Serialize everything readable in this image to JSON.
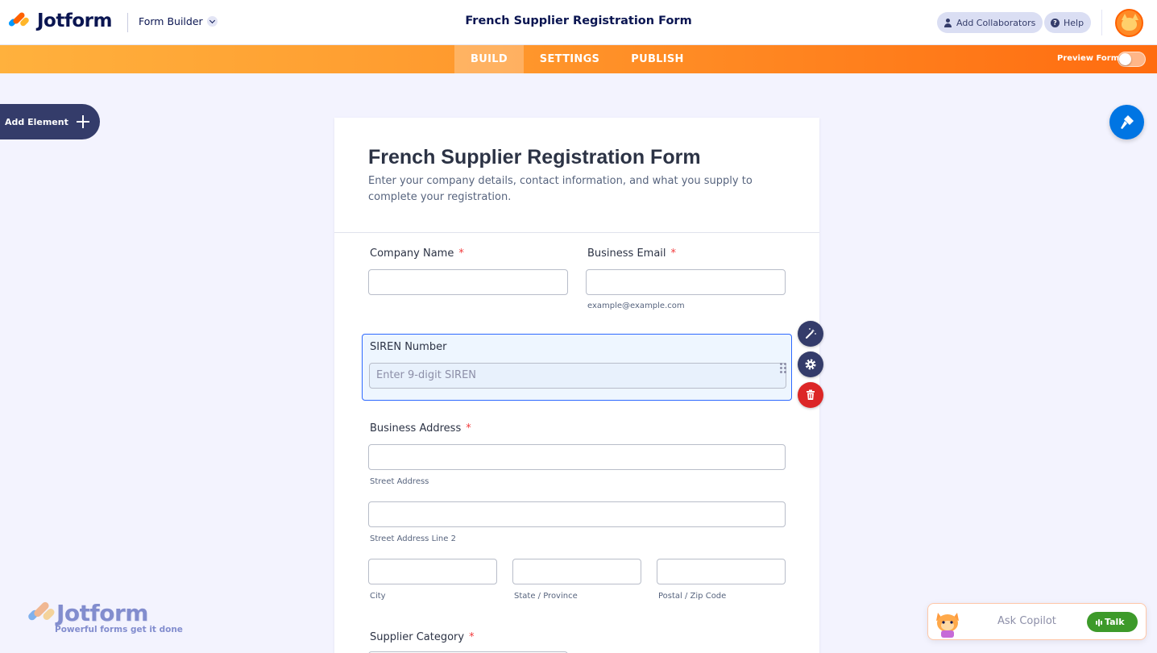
{
  "app": {
    "logo_text": "Jotform",
    "builder_label": "Form Builder",
    "form_title": "French Supplier Registration Form",
    "add_collaborators": "Add Collaborators",
    "help": "Help"
  },
  "nav": {
    "tabs": [
      "BUILD",
      "SETTINGS",
      "PUBLISH"
    ],
    "active_tab": "BUILD",
    "preview_label": "Preview Form",
    "preview_on": false
  },
  "sidebar": {
    "add_element": "Add Element"
  },
  "form": {
    "title": "French Supplier Registration Form",
    "subtitle": "Enter your company details, contact information, and what you supply to complete your registration.",
    "required_mark": "*",
    "company_name_label": "Company Name",
    "business_email_label": "Business Email",
    "email_sublabel": "example@example.com",
    "siren_label": "SIREN Number",
    "siren_placeholder": "Enter 9-digit SIREN",
    "address_label": "Business Address",
    "street_sublabel": "Street Address",
    "street2_sublabel": "Street Address Line 2",
    "city_sublabel": "City",
    "state_sublabel": "State / Province",
    "postal_sublabel": "Postal / Zip Code",
    "supplier_category_label": "Supplier Category"
  },
  "watermark": {
    "text": "Jotform",
    "tagline": "Powerful forms get it done"
  },
  "copilot": {
    "ask_label": "Ask Copilot",
    "talk_label": "Talk"
  },
  "colors": {
    "accent_orange": "#ff6100",
    "brand_navy": "#0a1551",
    "selection_blue": "#2e69ff",
    "delete_red": "#dc2626",
    "talk_green": "#3d9a2a"
  },
  "icons": [
    "jotform-logo-icon",
    "chevron-down-icon",
    "person-icon",
    "help-icon",
    "avatar-cat-icon",
    "plus-icon",
    "paint-roller-icon",
    "magic-wand-icon",
    "gear-icon",
    "trash-icon",
    "drag-handle-icon",
    "sound-wave-icon"
  ]
}
